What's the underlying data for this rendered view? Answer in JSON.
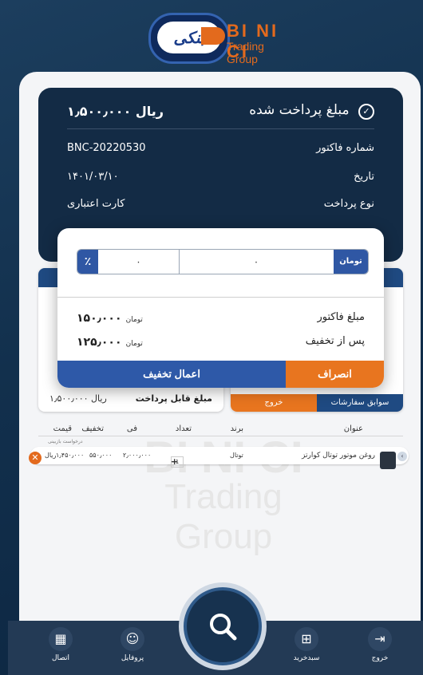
{
  "brand": {
    "name": "BI NI CI",
    "subtitle": "Trading Group",
    "mark_glyph": "ﺑﻨﮑﯽ"
  },
  "receipt": {
    "paid_label": "مبلغ پرداخت شده",
    "paid_amount": "۱٫۵۰۰٫۰۰۰  ریال",
    "invoice_label": "شماره فاکتور",
    "invoice_value": "BNC-20220530",
    "date_label": "تاریخ",
    "date_value": "۱۴۰۱/۰۳/۱۰",
    "payment_type_label": "نوع پرداخت",
    "payment_type_value": "کارت اعتباری"
  },
  "cart_panel": {
    "payable_label": "مبلغ قابل پرداخت",
    "payable_value": "۱٫۵۰۰٫۰۰۰  ریال",
    "exit_label": "خروج",
    "history_label": "سوابق سفارشات"
  },
  "table": {
    "headers": [
      "عنوان",
      "برند",
      "تعداد",
      "فی",
      "تخفیف",
      "قیمت"
    ],
    "note": "درخواست بازبینی",
    "rows": [
      {
        "title": "روغن موتور توتال کوارتز",
        "brand": "توتال",
        "qty": "1",
        "unit": "۲٫۰۰۰٫۰۰۰",
        "discount": "۵۵۰٫۰۰۰",
        "price": "۱٫۴۵۰٫۰۰۰",
        "currency": "ریال"
      }
    ]
  },
  "watermark": {
    "line1": "BI NI CI",
    "line2": "Trading Group"
  },
  "discount_modal": {
    "percent_symbol": "٪",
    "percent_value": "۰",
    "amount_value": "۰",
    "currency_label": "تومان",
    "invoice_amount_label": "مبلغ فاکتور",
    "invoice_amount_value": "۱۵۰٫۰۰۰",
    "after_discount_label": "پس از تخفیف",
    "after_discount_value": "۱۲۵٫۰۰۰",
    "unit": "تومان",
    "apply_label": "اعمال تخفیف",
    "cancel_label": "انصراف"
  },
  "bottom_nav": {
    "connect": "اتصال",
    "profile": "پروفایل",
    "cart": "سبدخرید",
    "exit": "خروج"
  },
  "colors": {
    "accent_blue": "#2e59a8",
    "accent_orange": "#e8751f",
    "dark_navy": "#132b45"
  }
}
